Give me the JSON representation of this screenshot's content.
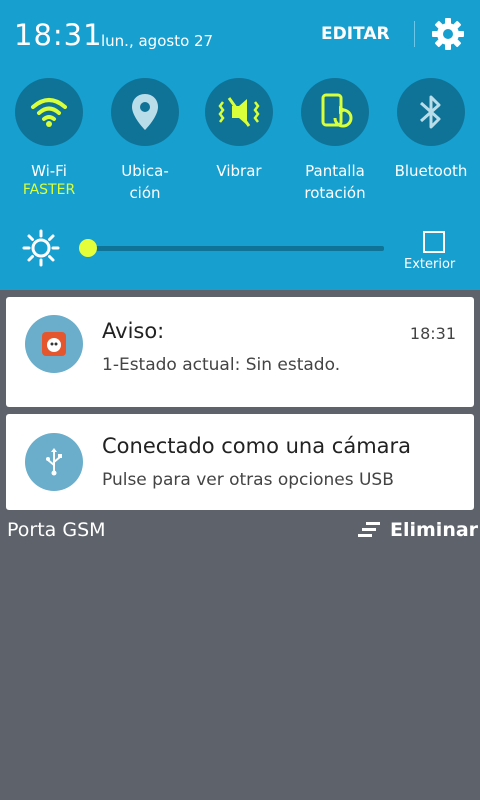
{
  "status": {
    "time": "18:31",
    "date": "lun., agosto 27",
    "edit_label": "EDITAR"
  },
  "toggles": [
    {
      "label": "Wi-Fi",
      "sub": "FASTER",
      "icon": "wifi-icon",
      "active": true
    },
    {
      "label": "Ubica-\nción",
      "sub": "",
      "icon": "location-icon",
      "active": false
    },
    {
      "label": "Vibrar",
      "sub": "",
      "icon": "vibrate-icon",
      "active": true
    },
    {
      "label": "Pantalla\nrotación",
      "sub": "",
      "icon": "screen-rotation-icon",
      "active": true
    },
    {
      "label": "Bluetooth",
      "sub": "",
      "icon": "bluetooth-icon",
      "active": false
    }
  ],
  "brightness": {
    "level": 0.0,
    "outdoor_label": "Exterior"
  },
  "notifications": [
    {
      "title": "Aviso:",
      "text": "1-Estado actual: Sin estado.",
      "time": "18:31",
      "icon": "app-icon"
    },
    {
      "title": "Conectado como una cámara",
      "text": "Pulse para ver otras opciones USB",
      "time": "",
      "icon": "usb-icon"
    }
  ],
  "footer": {
    "carrier": "Porta GSM",
    "clear_label": "Eliminar"
  },
  "colors": {
    "panel": "#179fd0",
    "toggle_bg": "#0f7397",
    "active": "#d8ff3a",
    "background": "#5e636b"
  }
}
